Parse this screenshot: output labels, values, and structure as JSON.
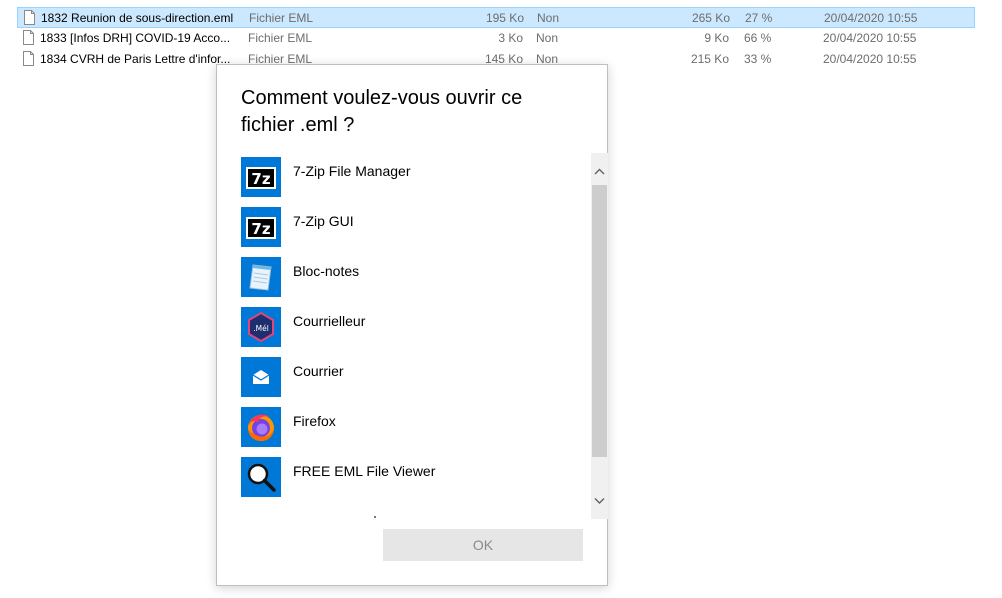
{
  "files": [
    {
      "name": "1832 Reunion de sous-direction.eml",
      "type": "Fichier EML",
      "size": "195 Ko",
      "protected": "Non",
      "packed": "265 Ko",
      "ratio": "27 %",
      "date": "20/04/2020 10:55",
      "selected": true
    },
    {
      "name": "1833 [Infos DRH] COVID-19  Acco...",
      "type": "Fichier EML",
      "size": "3 Ko",
      "protected": "Non",
      "packed": "9 Ko",
      "ratio": "66 %",
      "date": "20/04/2020 10:55",
      "selected": false
    },
    {
      "name": "1834 CVRH de Paris  Lettre d'infor...",
      "type": "Fichier EML",
      "size": "145 Ko",
      "protected": "Non",
      "packed": "215 Ko",
      "ratio": "33 %",
      "date": "20/04/2020 10:55",
      "selected": false
    }
  ],
  "dialog": {
    "title_line1": "Comment voulez-vous ouvrir ce",
    "title_line2": "fichier .eml ?",
    "apps": [
      {
        "label": "7-Zip File Manager",
        "icon": "sevenzip-icon"
      },
      {
        "label": "7-Zip GUI",
        "icon": "sevenzip-icon"
      },
      {
        "label": "Bloc-notes",
        "icon": "notepad-icon"
      },
      {
        "label": "Courrielleur",
        "icon": "courrielleur-mel-icon"
      },
      {
        "label": "Courrier",
        "icon": "mail-envelope-icon"
      },
      {
        "label": "Firefox",
        "icon": "firefox-icon"
      },
      {
        "label": "FREE EML File Viewer",
        "icon": "magnifier-icon"
      }
    ],
    "ok_label": "OK"
  },
  "colors": {
    "accent": "#0078d7",
    "selection": "#cce8ff",
    "selection_border": "#99d1ff",
    "button_disabled": "#e6e6e6"
  }
}
